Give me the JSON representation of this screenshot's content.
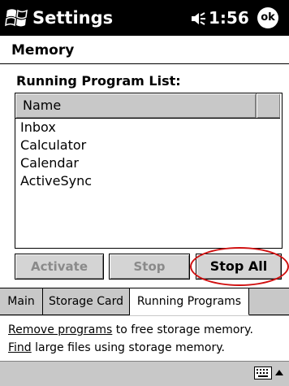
{
  "titlebar": {
    "app_title": "Settings",
    "clock": "1:56",
    "ok_label": "ok",
    "start_icon": "windows-flag-icon",
    "speaker_icon": "speaker-icon"
  },
  "page": {
    "title": "Memory",
    "list_label": "Running Program List:"
  },
  "list": {
    "column_name": "Name",
    "items": [
      "Inbox",
      "Calculator",
      "Calendar",
      "ActiveSync"
    ]
  },
  "buttons": {
    "activate": "Activate",
    "stop": "Stop",
    "stop_all": "Stop All"
  },
  "tabs": {
    "main": "Main",
    "storage": "Storage Card",
    "running": "Running Programs"
  },
  "info": {
    "line1_link": "Remove programs",
    "line1_text": " to free storage memory.",
    "line2_link": "Find",
    "line2_text": " large files using storage memory."
  },
  "colors": {
    "titlebar": "#000000",
    "highlight_ring": "#d01010",
    "chrome_gray": "#c8c8c8"
  }
}
